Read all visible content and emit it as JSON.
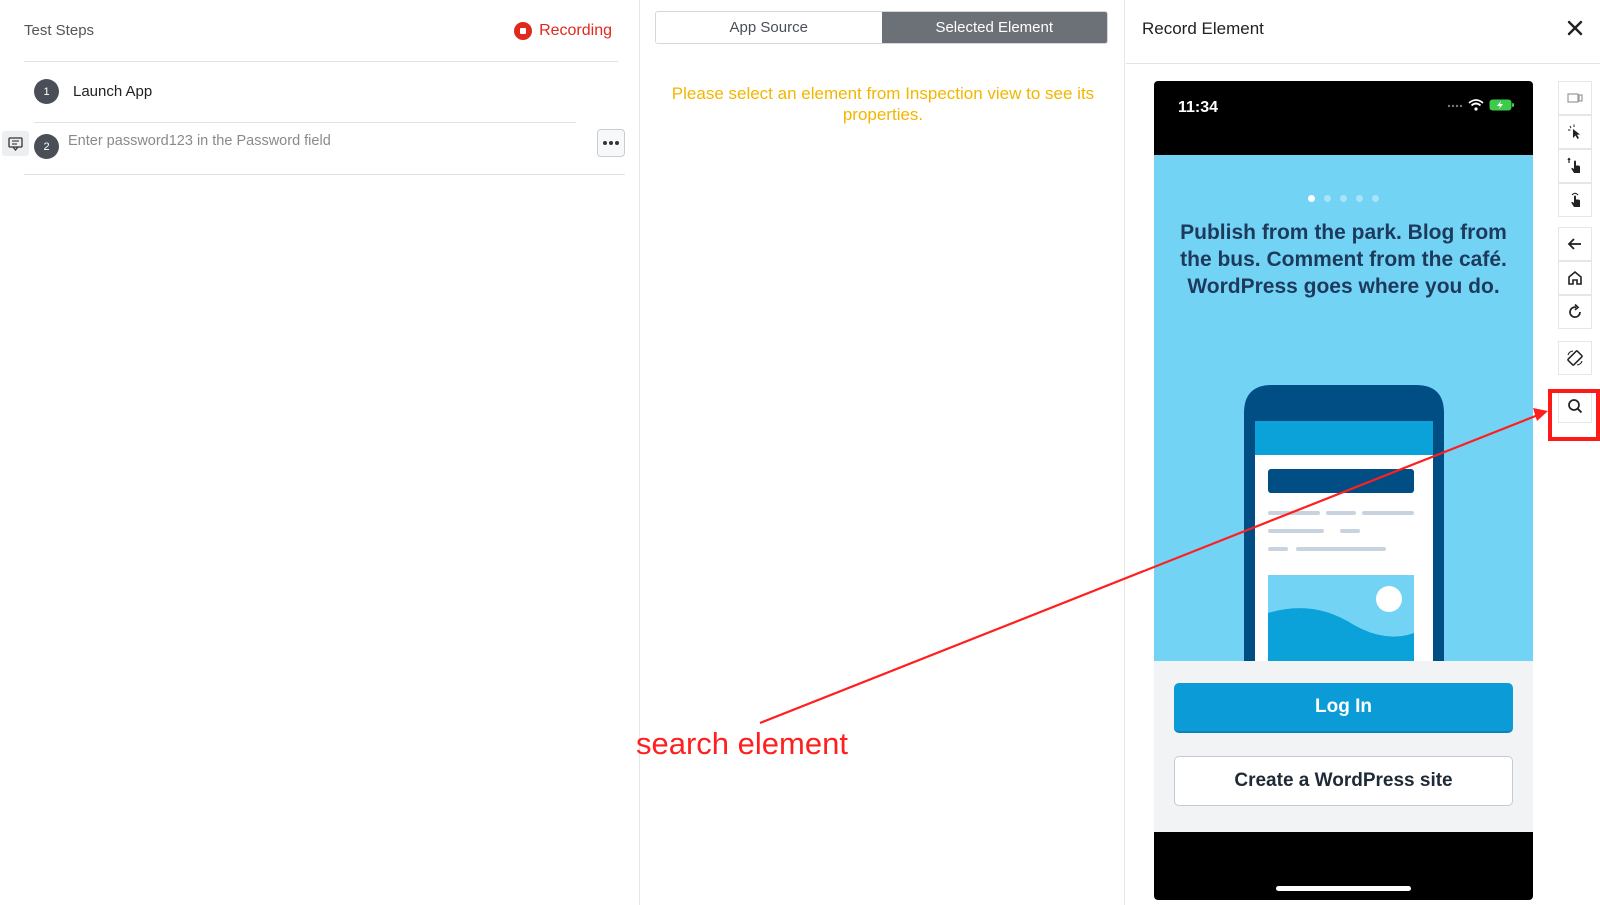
{
  "left_panel": {
    "title": "Test Steps",
    "recording_label": "Recording",
    "steps": [
      {
        "number": "1",
        "label": "Launch App"
      },
      {
        "number": "2",
        "label": "Enter password123 in the Password field"
      }
    ]
  },
  "middle_panel": {
    "tabs": [
      {
        "label": "App Source",
        "active": false
      },
      {
        "label": "Selected Element",
        "active": true
      }
    ],
    "hint": "Please select an element from Inspection view to see its properties."
  },
  "right_panel": {
    "title": "Record Element",
    "device": {
      "status_time": "11:34",
      "headline": "Publish from the park. Blog from the bus. Comment from the café. WordPress goes where you do.",
      "login_label": "Log In",
      "create_label": "Create a WordPress site"
    },
    "toolbar_icons": [
      "device-icon",
      "select-pointer-icon",
      "swipe-icon",
      "tap-icon",
      "back-icon",
      "home-icon",
      "refresh-icon",
      "rotate-icon",
      "search-icon"
    ]
  },
  "annotation": {
    "text": "search element",
    "color": "#ff1f1f"
  },
  "colors": {
    "recording": "#e0281f",
    "hint": "#f2b600",
    "active_tab": "#6c7077",
    "login_button": "#0b9cd8",
    "device_screen": "#73d3f5"
  }
}
